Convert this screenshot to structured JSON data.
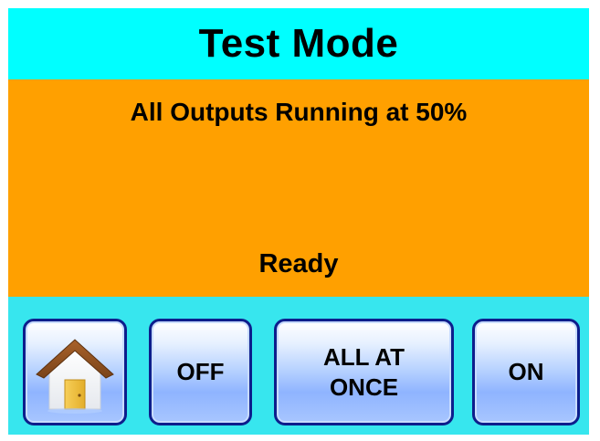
{
  "header": {
    "title": "Test Mode"
  },
  "status": {
    "message": "All Outputs Running at 50%",
    "state": "Ready"
  },
  "buttons": {
    "home": {
      "icon": "home-icon"
    },
    "off_label": "OFF",
    "all_at_once_label": "ALL AT\nONCE",
    "on_label": "ON"
  },
  "colors": {
    "title_bar": "#00ffff",
    "status_panel": "#ffa000",
    "background": "#37e6ee",
    "button_border": "#0d1e8c"
  }
}
